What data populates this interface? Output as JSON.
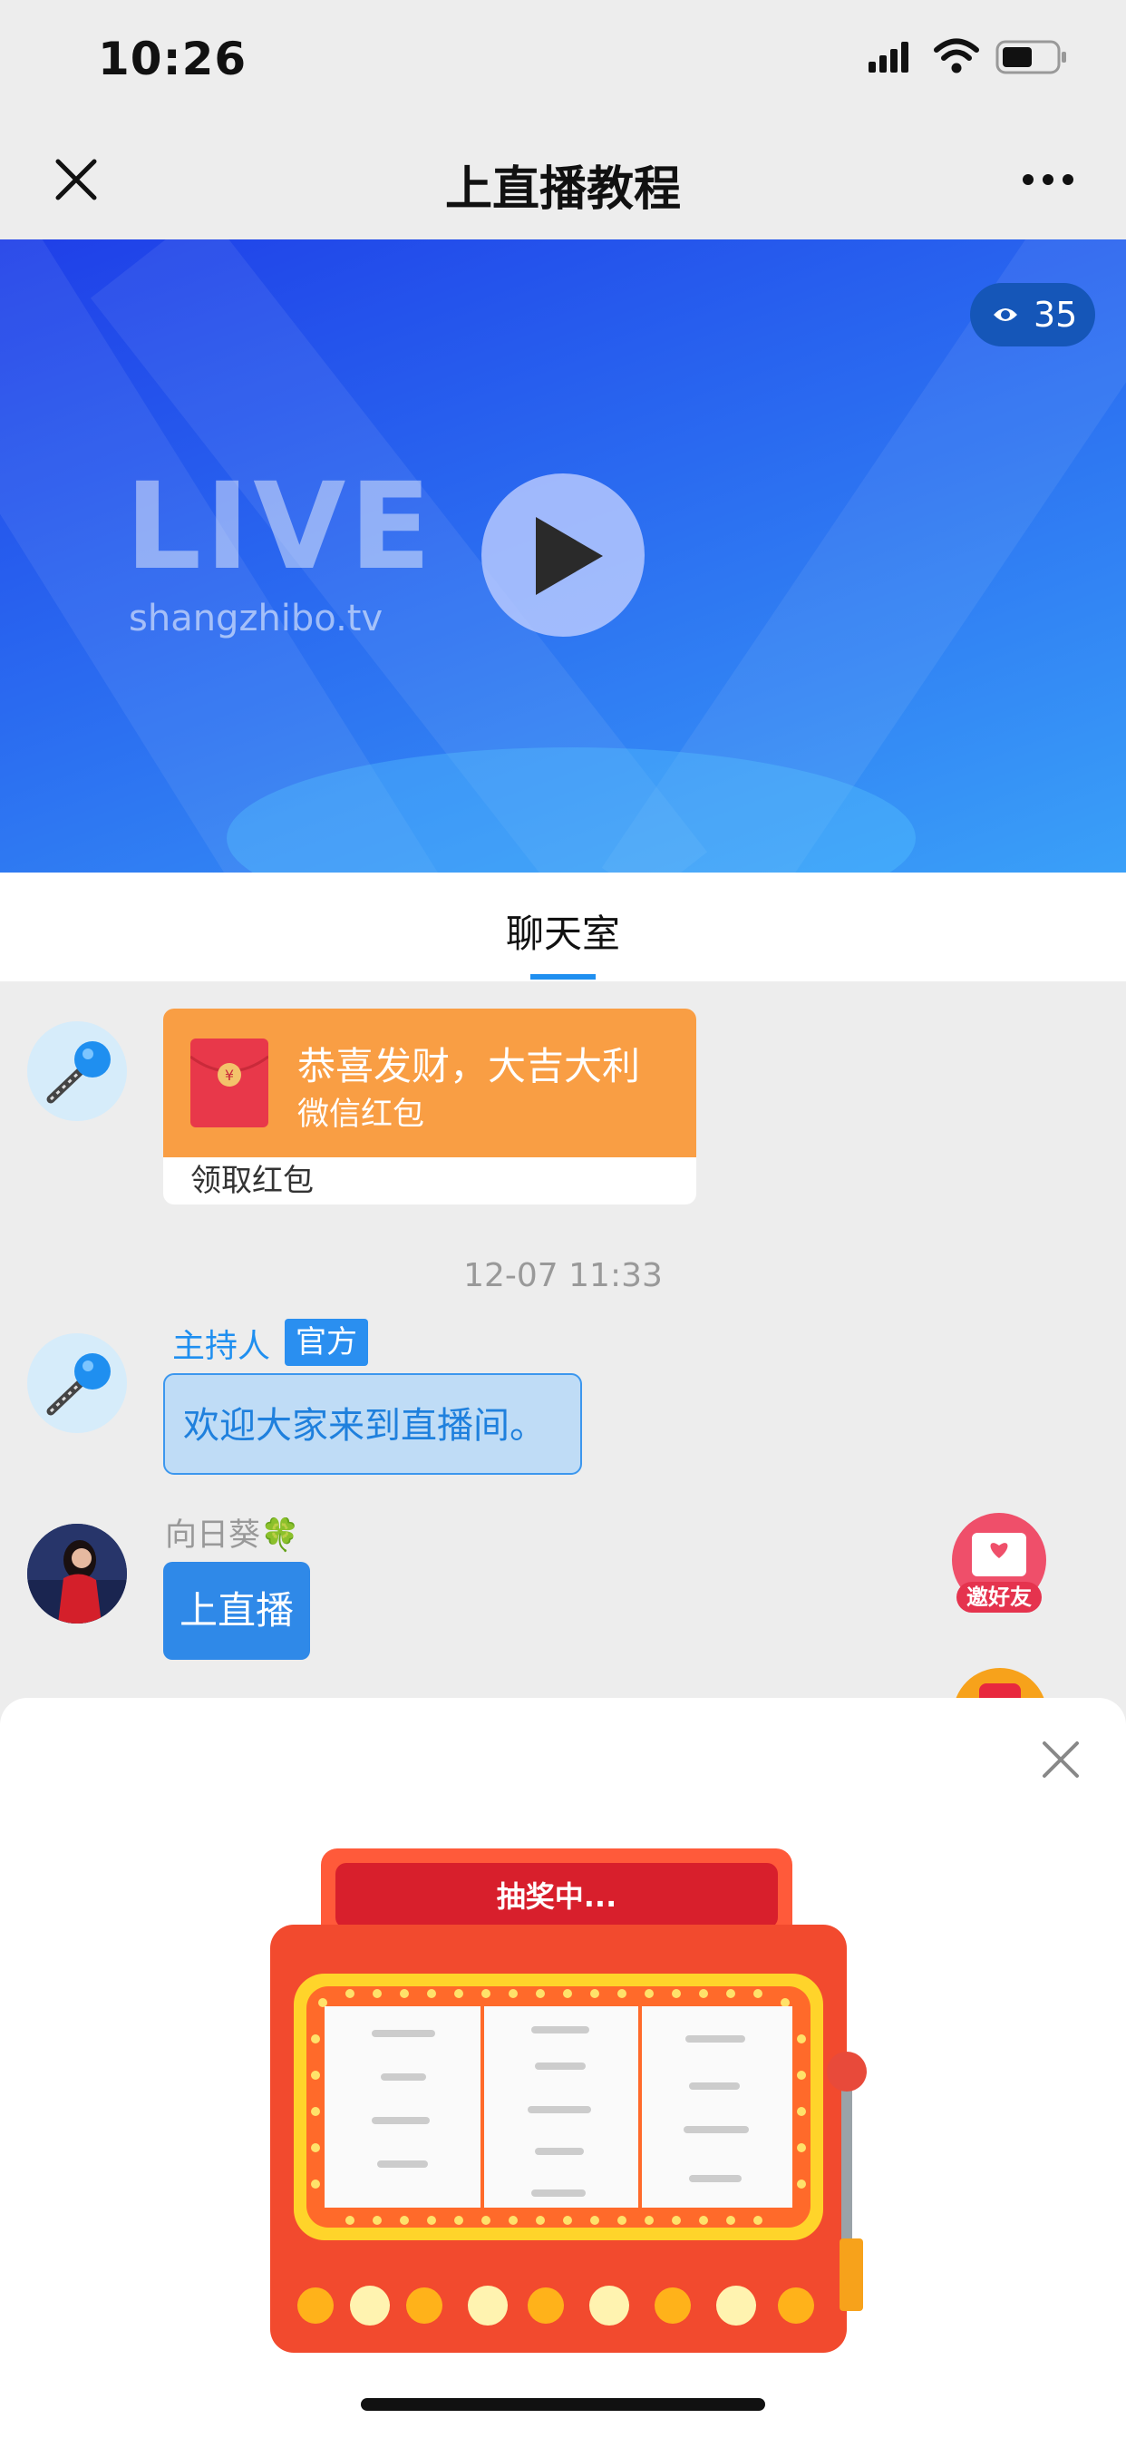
{
  "status_bar": {
    "time": "10:26"
  },
  "nav": {
    "title": "上直播教程"
  },
  "video": {
    "viewer_count": "35",
    "live_text": "LIVE",
    "live_url": "shangzhibo.tv"
  },
  "tabs": [
    {
      "label": "聊天室",
      "active": true
    }
  ],
  "chat": {
    "red_packet": {
      "title": "恭喜发财，大吉大利",
      "subtitle": "微信红包",
      "claim_label": "领取红包"
    },
    "timestamp": "12-07 11:33",
    "host_message": {
      "name": "主持人",
      "badge": "官方",
      "text": "欢迎大家来到直播间。"
    },
    "user_message": {
      "name": "向日葵🍀",
      "text": "上直播"
    },
    "invite_label": "邀好友"
  },
  "lottery": {
    "status": "抽奖中..."
  },
  "colors": {
    "accent": "#1f8ff0",
    "red_packet": "#f99e44",
    "lottery_red": "#f24a2e"
  }
}
